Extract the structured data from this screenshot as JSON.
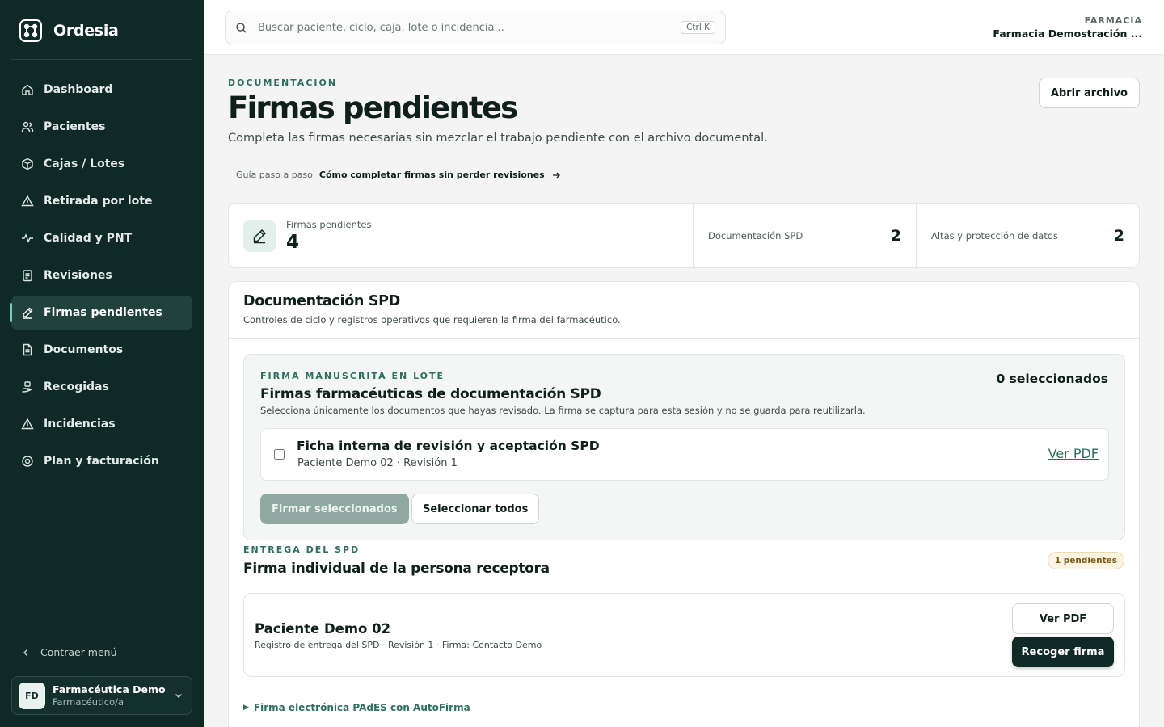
{
  "brand": {
    "name": "Ordesia"
  },
  "sidebar": {
    "items": [
      {
        "label": "Dashboard",
        "icon": "home-icon"
      },
      {
        "label": "Pacientes",
        "icon": "users-icon"
      },
      {
        "label": "Cajas / Lotes",
        "icon": "box-icon"
      },
      {
        "label": "Retirada por lote",
        "icon": "alert-triangle-icon"
      },
      {
        "label": "Calidad y PNT",
        "icon": "activity-icon"
      },
      {
        "label": "Revisiones",
        "icon": "clipboard-icon"
      },
      {
        "label": "Firmas pendientes",
        "icon": "pen-icon",
        "active": true
      },
      {
        "label": "Documentos",
        "icon": "file-icon"
      },
      {
        "label": "Recogidas",
        "icon": "hand-package-icon"
      },
      {
        "label": "Incidencias",
        "icon": "warning-icon"
      },
      {
        "label": "Plan y facturación",
        "icon": "settings-icon"
      }
    ],
    "collapse_label": "Contraer menú",
    "user": {
      "initials": "FD",
      "name": "Farmacéutica Demo",
      "role": "Farmacéutico/a"
    }
  },
  "header": {
    "search_placeholder": "Buscar paciente, ciclo, caja, lote o incidencia...",
    "shortcut": "Ctrl K",
    "pharmacy_label": "FARMACIA",
    "pharmacy_name": "Farmacia Demostración ..."
  },
  "page": {
    "eyebrow": "DOCUMENTACIÓN",
    "title": "Firmas pendientes",
    "subtitle": "Completa las firmas necesarias sin mezclar el trabajo pendiente con el archivo documental.",
    "open_archive": "Abrir archivo",
    "guide_label": "Guía paso a paso",
    "guide_link": "Cómo completar firmas sin perder revisiones"
  },
  "stats": {
    "main_label": "Firmas pendientes",
    "main_value": "4",
    "spd_label": "Documentación SPD",
    "spd_value": "2",
    "altas_label": "Altas y protección de datos",
    "altas_value": "2"
  },
  "panel": {
    "title": "Documentación SPD",
    "description": "Controles de ciclo y registros operativos que requieren la firma del farmacéutico.",
    "batch": {
      "eyebrow": "FIRMA MANUSCRITA EN LOTE",
      "title": "Firmas farmacéuticas de documentación SPD",
      "description": "Selecciona únicamente los documentos que hayas revisado. La firma se captura para esta sesión y no se guarda para reutilizarla.",
      "selected_count": "0 seleccionados",
      "document": {
        "title": "Ficha interna de revisión y aceptación SPD",
        "meta": "Paciente Demo 02 · Revisión 1",
        "link": "Ver PDF"
      },
      "sign_button": "Firmar seleccionados",
      "select_all_button": "Seleccionar todos"
    },
    "delivery": {
      "eyebrow": "ENTREGA DEL SPD",
      "title": "Firma individual de la persona receptora",
      "badge": "1 pendientes",
      "patient": "Paciente Demo 02",
      "meta": "Registro de entrega del SPD · Revisión 1 · Firma: Contacto Demo",
      "view_button": "Ver PDF",
      "collect_button": "Recoger firma"
    },
    "autofirma_label": "Firma electrónica PAdES con AutoFirma"
  }
}
